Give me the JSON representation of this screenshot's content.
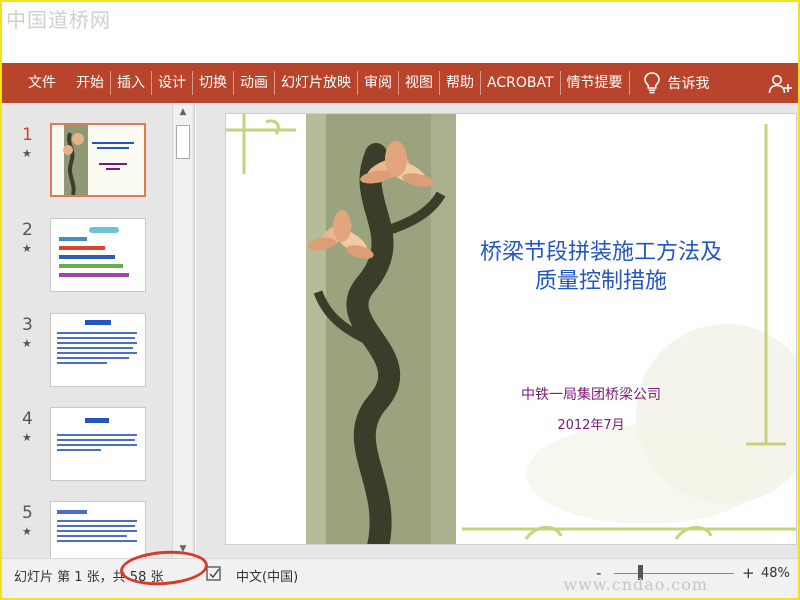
{
  "watermarks": {
    "top": "中国道桥网",
    "bottom": "www.cndao.com"
  },
  "ribbon": {
    "tabs": [
      "文件",
      "开始",
      "插入",
      "设计",
      "切换",
      "动画",
      "幻灯片放映",
      "审阅",
      "视图",
      "帮助",
      "ACROBAT",
      "情节提要"
    ],
    "tell_me": "告诉我",
    "color": "#b8442b"
  },
  "thumbnails": [
    {
      "number": "1",
      "star": "★"
    },
    {
      "number": "2",
      "star": "★"
    },
    {
      "number": "3",
      "star": "★"
    },
    {
      "number": "4",
      "star": "★"
    },
    {
      "number": "5",
      "star": "★"
    }
  ],
  "slide": {
    "title_line1": "桥梁节段拼装施工方法及",
    "title_line2": "质量控制措施",
    "company": "中铁一局集团桥梁公司",
    "date": "2012年7月"
  },
  "status": {
    "slide_info": "幻灯片 第 1 张，共 58 张",
    "language": "中文(中国)",
    "zoom_minus": "-",
    "zoom_plus": "+",
    "zoom_level": "48%"
  }
}
